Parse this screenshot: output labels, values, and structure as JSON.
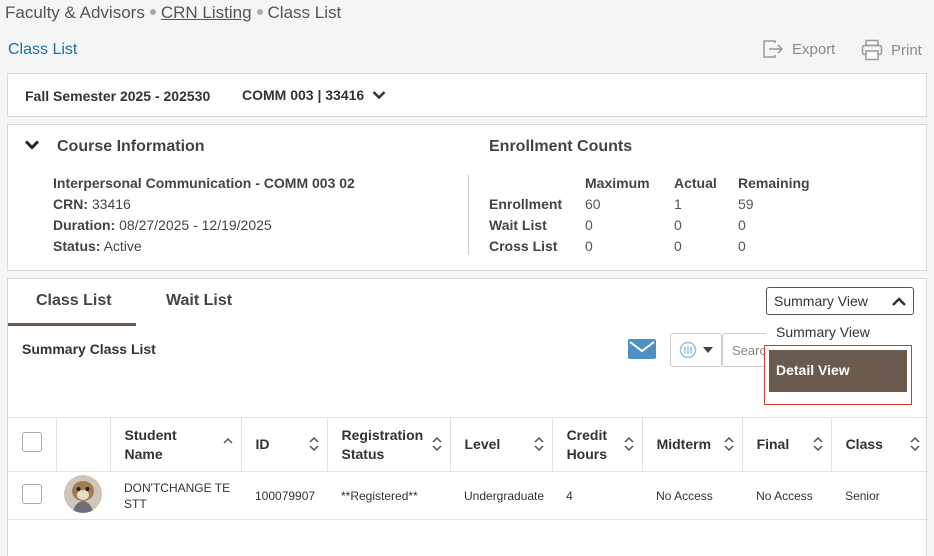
{
  "breadcrumb": {
    "root": "Faculty & Advisors",
    "middle": "CRN Listing",
    "current": "Class List"
  },
  "page_title": "Class List",
  "toolbar": {
    "export_label": "Export",
    "print_label": "Print"
  },
  "term_bar": {
    "term": "Fall Semester 2025 - 202530",
    "crn": "COMM 003 | 33416"
  },
  "course_info": {
    "title": "Course Information",
    "course_name": "Interpersonal Communication - COMM 003 02",
    "crn_label": "CRN:",
    "crn_value": "33416",
    "duration_label": "Duration:",
    "duration_value": "08/27/2025 - 12/19/2025",
    "status_label": "Status:",
    "status_value": "Active"
  },
  "enrollment": {
    "title": "Enrollment Counts",
    "headers": [
      "Maximum",
      "Actual",
      "Remaining"
    ],
    "rows": [
      {
        "label": "Enrollment",
        "max": "60",
        "actual": "1",
        "remaining": "59"
      },
      {
        "label": "Wait List",
        "max": "0",
        "actual": "0",
        "remaining": "0"
      },
      {
        "label": "Cross List",
        "max": "0",
        "actual": "0",
        "remaining": "0"
      }
    ]
  },
  "tabs": {
    "class_list": "Class List",
    "wait_list": "Wait List"
  },
  "summary_title": "Summary Class List",
  "search": {
    "placeholder": "Search"
  },
  "view_select": {
    "selected": "Summary View",
    "options": [
      "Summary View",
      "Detail View"
    ]
  },
  "grid": {
    "headers": {
      "student_name": "Student Name",
      "id": "ID",
      "registration_status": "Registration Status",
      "level": "Level",
      "credit_hours": "Credit Hours",
      "midterm": "Midterm",
      "final": "Final",
      "class": "Class"
    },
    "rows": [
      {
        "name": "DON'TCHANGE TE STT",
        "id": "100079907",
        "registration_status": "**Registered**",
        "level": "Undergraduate",
        "credit_hours": "4",
        "midterm": "No Access",
        "final": "No Access",
        "class": "Senior"
      }
    ]
  },
  "colors": {
    "accent": "#1f6fa3",
    "brand": "#6b5a4e",
    "highlight": "#dd3333",
    "mail": "#4f8fc4"
  }
}
